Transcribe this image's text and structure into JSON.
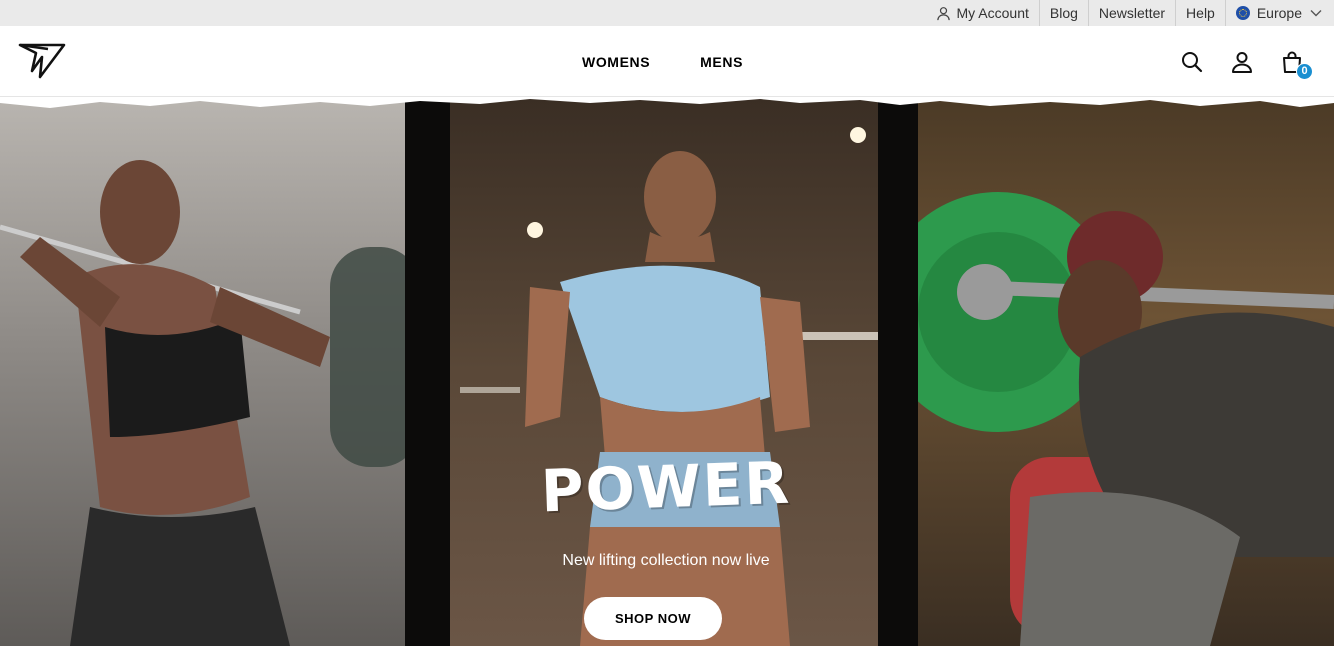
{
  "utility_bar": {
    "my_account": "My Account",
    "blog": "Blog",
    "newsletter": "Newsletter",
    "help": "Help",
    "region": "Europe"
  },
  "header": {
    "logo_icon": "gymshark-logo-icon",
    "nav": [
      "WOMENS",
      "MENS"
    ],
    "search_icon": "search-icon",
    "account_icon": "user-icon",
    "cart_icon": "bag-icon",
    "cart_count": "0"
  },
  "hero": {
    "headline": "POWER",
    "subline": "New lifting collection now live",
    "cta": "SHOP NOW"
  },
  "colors": {
    "utility_bg": "#eaeaea",
    "cart_badge": "#1a8fd1",
    "hero_text": "#ffffff"
  }
}
